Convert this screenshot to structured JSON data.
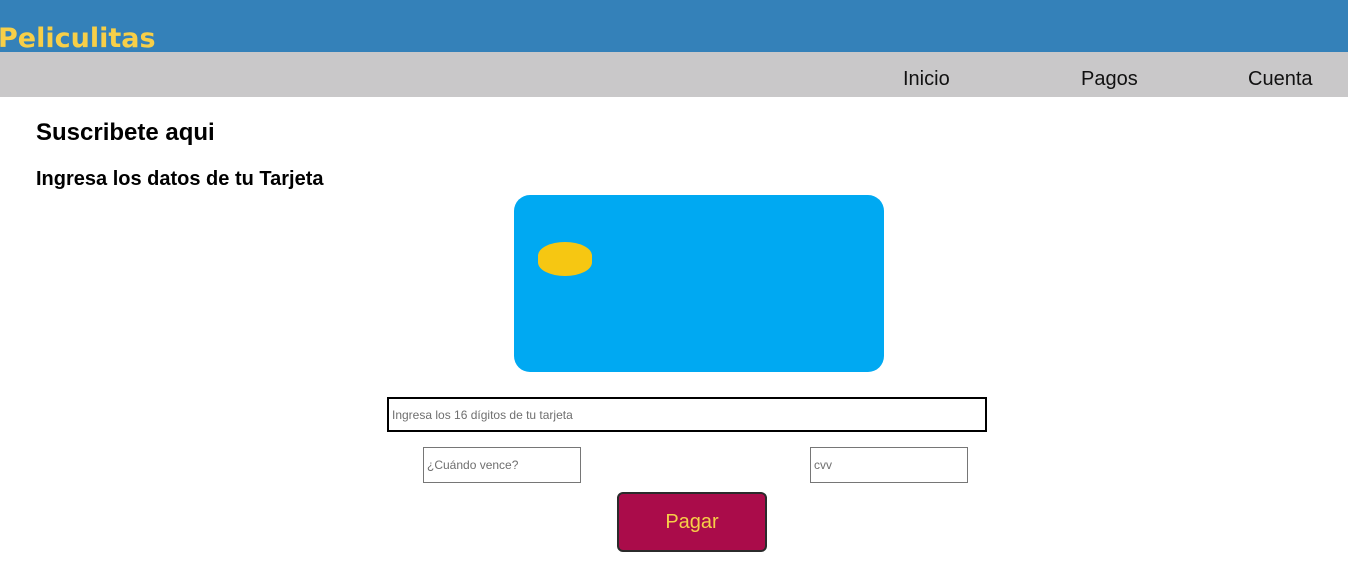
{
  "header": {
    "brand": "Peliculitas"
  },
  "nav": {
    "items": [
      "Inicio",
      "Pagos",
      "Cuenta"
    ]
  },
  "main": {
    "title": "Suscribete aqui",
    "subtitle": "Ingresa los datos de tu Tarjeta"
  },
  "form": {
    "card_number_placeholder": "Ingresa los 16 dígitos de tu tarjeta",
    "expiry_placeholder": "¿Cuándo vence?",
    "cvv_placeholder": "cvv",
    "submit_label": "Pagar"
  },
  "colors": {
    "header_bg": "#3481b9",
    "brand": "#f7cf48",
    "nav_bg": "#c9c8c9",
    "card": "#00a9f2",
    "chip": "#f6c712",
    "button_bg": "#aa0c4a",
    "button_text": "#f7cf48"
  }
}
